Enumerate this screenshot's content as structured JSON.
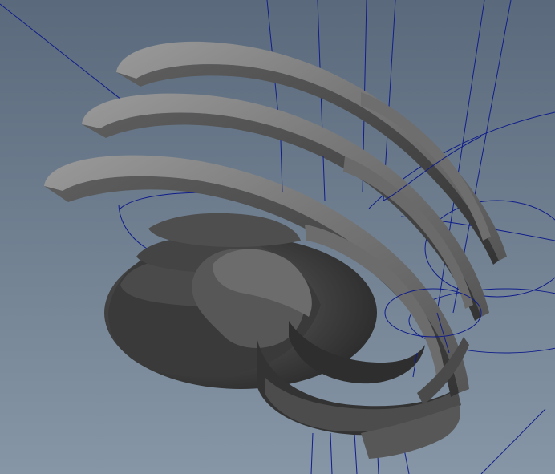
{
  "viewport": {
    "background_top": "#5a6a7c",
    "background_bottom": "#8696a6",
    "wire_color": "#101d8a",
    "shape_light": "#8e8e8e",
    "shape_mid": "#5c5c5c",
    "shape_dark": "#2f2f2f",
    "objects": [
      "curve-wireframes",
      "swept-ribbon-geometry"
    ]
  }
}
